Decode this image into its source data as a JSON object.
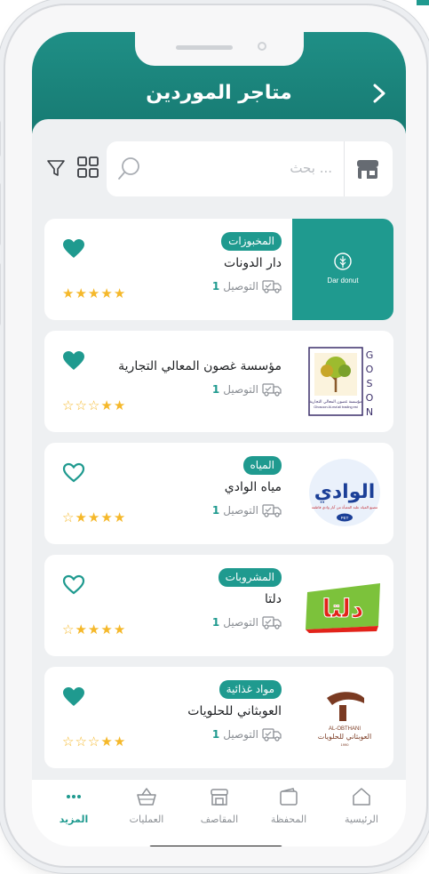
{
  "header": {
    "title": "متاجر الموردين"
  },
  "search": {
    "placeholder": "بحث ..."
  },
  "colors": {
    "accent": "#1f9a8f",
    "star": "#f5b82a",
    "heart": "#1f9a8f"
  },
  "suppliers": [
    {
      "name": "دار الدونات",
      "tag": "المخبوزات",
      "delivery_label": "التوصيل",
      "delivery_count": "1",
      "rating": 5,
      "favorite": true,
      "logo_text": "Dar donut",
      "logo": "dar-donut-logo"
    },
    {
      "name": "مؤسسة غصون المعالي التجارية",
      "tag": "",
      "delivery_label": "التوصيل",
      "delivery_count": "1",
      "rating": 2,
      "favorite": true,
      "logo": "ghosoon-logo",
      "logo_caption": "مؤسسة غصون المعالي التجارية",
      "logo_caption_en": "Ghosoon Al-ma'ali trading est",
      "logo_side_letters": [
        "G",
        "O",
        "S",
        "O",
        "N"
      ]
    },
    {
      "name": "مياه الوادي",
      "tag": "المياه",
      "delivery_label": "التوصيل",
      "delivery_count": "1",
      "rating": 4,
      "favorite": false,
      "logo": "alwadi-logo",
      "logo_text": "الوادي",
      "logo_sub": "PET",
      "logo_tagline": "مصنع المياه علبة المعبأة من آبار وادي فاطمة"
    },
    {
      "name": "دلتا",
      "tag": "المشروبات",
      "delivery_label": "التوصيل",
      "delivery_count": "1",
      "rating": 4,
      "favorite": false,
      "logo": "delta-logo",
      "logo_text": "دلتا"
    },
    {
      "name": "العوبثاني للحلويات",
      "tag": "مواد غذائية",
      "delivery_label": "التوصيل",
      "delivery_count": "1",
      "rating": 2,
      "favorite": true,
      "logo": "al-obthani-logo",
      "logo_text_en": "AL-OBTHANI",
      "logo_text_ar": "العوبثاني للحلويات",
      "logo_year": "1990"
    }
  ],
  "bottom_nav": {
    "items": [
      {
        "label": "الرئيسية",
        "icon": "home-icon",
        "active": false
      },
      {
        "label": "المحفظة",
        "icon": "wallet-icon",
        "active": false
      },
      {
        "label": "المقاصف",
        "icon": "canteen-icon",
        "active": false
      },
      {
        "label": "العمليات",
        "icon": "basket-icon",
        "active": false
      },
      {
        "label": "المزيد",
        "icon": "more-icon",
        "active": true
      }
    ]
  }
}
